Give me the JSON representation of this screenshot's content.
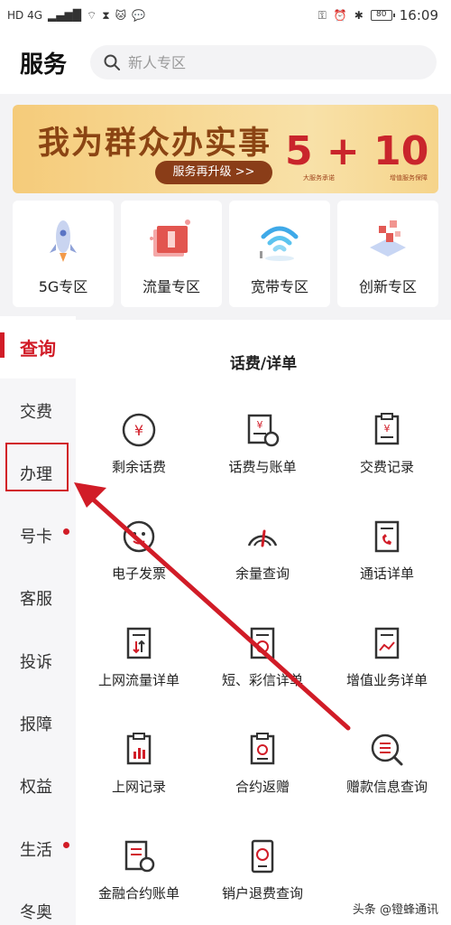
{
  "status_bar": {
    "network1": "HD 4G",
    "network2": "HD 4G",
    "battery": "80",
    "time": "16:09"
  },
  "header": {
    "title": "服务",
    "search_placeholder": "新人专区"
  },
  "banner": {
    "title": "我为群众办实事",
    "button": "服务再升级 >>",
    "number": "5 + 10",
    "sub1": "大服务承诺",
    "sub2": "增值服务保障"
  },
  "zones": [
    {
      "label": "5G专区",
      "icon": "rocket-icon"
    },
    {
      "label": "流量专区",
      "icon": "data-flow-icon"
    },
    {
      "label": "宽带专区",
      "icon": "wifi-icon"
    },
    {
      "label": "创新专区",
      "icon": "innovation-icon"
    }
  ],
  "sidebar": {
    "items": [
      {
        "label": "查询",
        "active": true,
        "dot": false
      },
      {
        "label": "交费",
        "active": false,
        "dot": false
      },
      {
        "label": "办理",
        "active": false,
        "dot": false
      },
      {
        "label": "号卡",
        "active": false,
        "dot": true
      },
      {
        "label": "客服",
        "active": false,
        "dot": false
      },
      {
        "label": "投诉",
        "active": false,
        "dot": false
      },
      {
        "label": "报障",
        "active": false,
        "dot": false
      },
      {
        "label": "权益",
        "active": false,
        "dot": false
      },
      {
        "label": "生活",
        "active": false,
        "dot": true
      },
      {
        "label": "冬奥",
        "active": false,
        "dot": false
      }
    ]
  },
  "main": {
    "section_title": "话费/详单",
    "items": [
      {
        "label": "剩余话费",
        "icon": "yen-circle-icon"
      },
      {
        "label": "话费与账单",
        "icon": "bill-icon"
      },
      {
        "label": "交费记录",
        "icon": "receipt-icon"
      },
      {
        "label": "电子发票",
        "icon": "invoice-icon"
      },
      {
        "label": "余量查询",
        "icon": "gauge-icon"
      },
      {
        "label": "通话详单",
        "icon": "call-list-icon"
      },
      {
        "label": "上网流量详单",
        "icon": "data-list-icon"
      },
      {
        "label": "短、彩信详单",
        "icon": "sms-list-icon"
      },
      {
        "label": "增值业务详单",
        "icon": "value-added-icon"
      },
      {
        "label": "上网记录",
        "icon": "chart-doc-icon"
      },
      {
        "label": "合约返赠",
        "icon": "contract-icon"
      },
      {
        "label": "赠款信息查询",
        "icon": "search-list-icon"
      },
      {
        "label": "金融合约账单",
        "icon": "finance-icon"
      },
      {
        "label": "销户退费查询",
        "icon": "refund-icon"
      }
    ]
  },
  "watermark": "头条 @镫蜂通讯",
  "colors": {
    "accent": "#d11c27",
    "banner_text": "#8b4413"
  }
}
